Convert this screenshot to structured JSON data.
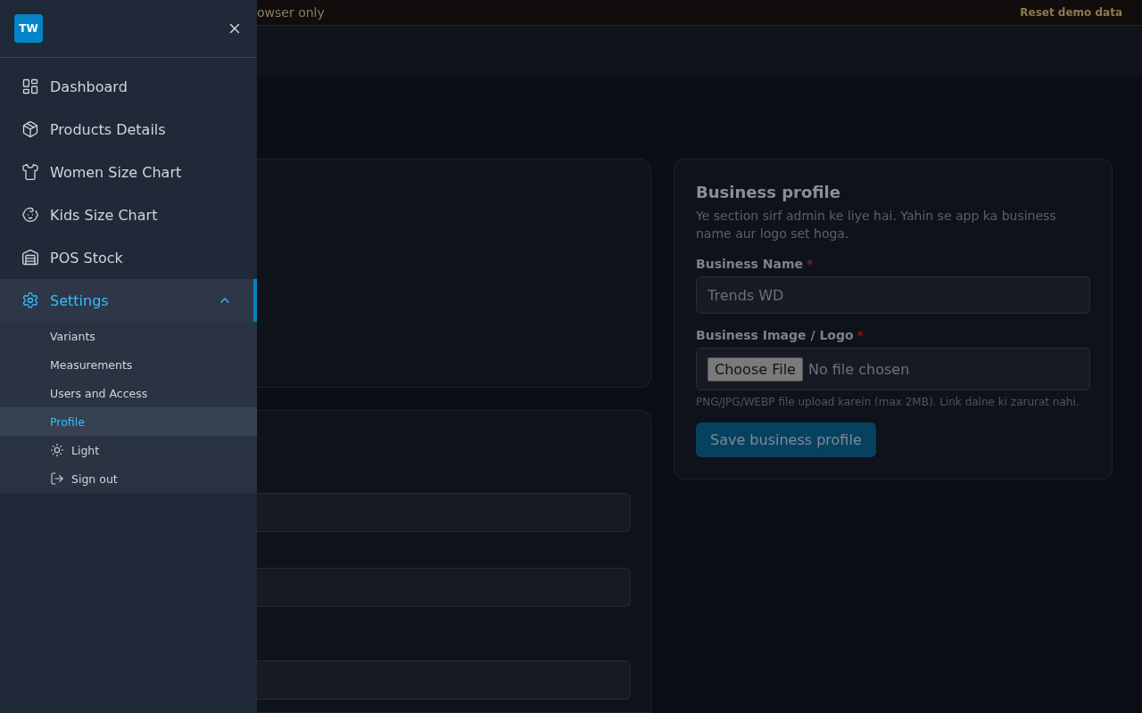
{
  "sidebar": {
    "logo": "TW",
    "items": [
      {
        "label": "Dashboard",
        "selected": false
      },
      {
        "label": "Products Details",
        "selected": false
      },
      {
        "label": "Women Size Chart",
        "selected": false
      },
      {
        "label": "Kids Size Chart",
        "selected": false
      },
      {
        "label": "POS Stock",
        "selected": false
      },
      {
        "label": "Settings",
        "selected": true,
        "expanded": true,
        "children": [
          {
            "label": "Variants",
            "selected": false
          },
          {
            "label": "Measurements",
            "selected": false
          },
          {
            "label": "Users and Access",
            "selected": false
          },
          {
            "label": "Profile",
            "selected": true
          }
        ]
      }
    ],
    "actions": [
      {
        "label": "Light",
        "kind": "theme"
      },
      {
        "label": "Sign out",
        "kind": "signout"
      }
    ]
  },
  "banner": {
    "text": "owser only",
    "action": "Reset demo data"
  },
  "business_profile": {
    "title": "Business profile",
    "description": "Ye section sirf admin ke liye hai. Yahin se app ka business name aur logo set hoga.",
    "fields": [
      {
        "kind": "text",
        "label": "Business Name",
        "required_mark": "*",
        "value": "Trends WD"
      },
      {
        "kind": "file",
        "label": "Business Image / Logo",
        "required_mark": "*",
        "button": "Choose File",
        "status": "No file chosen",
        "hint": "PNG/JPG/WEBP file upload karein (max 2MB). Link dalne ki zarurat nahi."
      }
    ],
    "save": "Save business profile"
  }
}
